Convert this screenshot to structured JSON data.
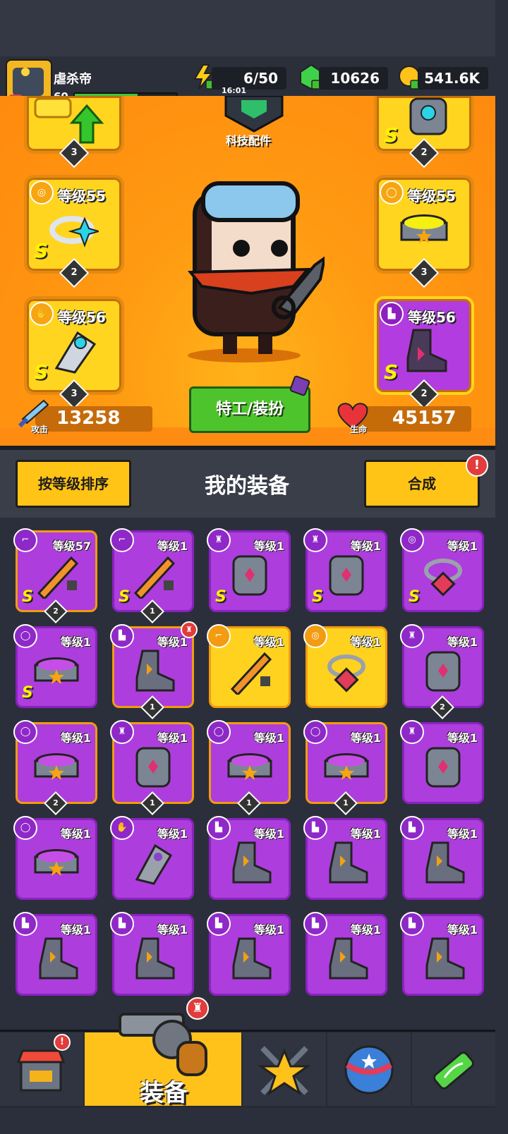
{
  "player": {
    "name": "虐杀帝",
    "level": "60",
    "avatar_level": "54",
    "xp_fraction": 0.62
  },
  "resources": {
    "energy": "6/50",
    "time": "16:01",
    "gems": "10626",
    "coins": "541.6K"
  },
  "colors": {
    "orange": "#ff9a12",
    "yellow": "#ffd21f",
    "purple": "#ad3ddd",
    "green": "#4ec42c"
  },
  "loadout": {
    "tech_label": "科技配件",
    "slots": [
      {
        "name": "weapon-slot",
        "level": "",
        "count": "3",
        "grade": "",
        "icon": "up-arrow-icon"
      },
      {
        "name": "armor-slot",
        "level": "",
        "count": "2",
        "grade": "S",
        "icon": "armor-icon"
      },
      {
        "name": "necklace-slot",
        "level": "等级55",
        "count": "2",
        "grade": "S",
        "icon": "necklace-icon"
      },
      {
        "name": "belt-slot",
        "level": "等级55",
        "count": "3",
        "grade": "",
        "icon": "belt-icon"
      },
      {
        "name": "glove-slot",
        "level": "等级56",
        "count": "3",
        "grade": "S",
        "icon": "glove-icon"
      },
      {
        "name": "boot-slot",
        "level": "等级56",
        "count": "2",
        "grade": "S",
        "icon": "boot-icon"
      }
    ],
    "agent_button": "特工/装扮",
    "attack_label": "攻击",
    "attack_value": "13258",
    "hp_label": "生命",
    "hp_value": "45157"
  },
  "toolbar": {
    "sort_button": "按等级排序",
    "title": "我的装备",
    "merge_button": "合成",
    "merge_alert": "!"
  },
  "items": [
    {
      "kind": "weapon",
      "level": "等级57",
      "grade": "S",
      "count": "2",
      "style": "py"
    },
    {
      "kind": "weapon",
      "level": "等级1",
      "grade": "S",
      "count": "1",
      "style": "p"
    },
    {
      "kind": "armor",
      "level": "等级1",
      "grade": "S",
      "count": "",
      "style": "p"
    },
    {
      "kind": "armor",
      "level": "等级1",
      "grade": "S",
      "count": "",
      "style": "p"
    },
    {
      "kind": "necklace",
      "level": "等级1",
      "grade": "S",
      "count": "",
      "style": "p"
    },
    {
      "kind": "belt",
      "level": "等级1",
      "grade": "S",
      "count": "",
      "style": "p"
    },
    {
      "kind": "boot",
      "level": "等级1",
      "grade": "",
      "count": "1",
      "style": "py",
      "alert": true
    },
    {
      "kind": "weapon",
      "level": "等级1",
      "grade": "",
      "count": "",
      "style": "y"
    },
    {
      "kind": "necklace",
      "level": "等级1",
      "grade": "",
      "count": "",
      "style": "y"
    },
    {
      "kind": "armor",
      "level": "等级1",
      "grade": "",
      "count": "2",
      "style": "p"
    },
    {
      "kind": "belt",
      "level": "等级1",
      "grade": "",
      "count": "2",
      "style": "py"
    },
    {
      "kind": "armor",
      "level": "等级1",
      "grade": "",
      "count": "1",
      "style": "py"
    },
    {
      "kind": "belt",
      "level": "等级1",
      "grade": "",
      "count": "1",
      "style": "py"
    },
    {
      "kind": "belt",
      "level": "等级1",
      "grade": "",
      "count": "1",
      "style": "py"
    },
    {
      "kind": "armor",
      "level": "等级1",
      "grade": "",
      "count": "",
      "style": "p"
    },
    {
      "kind": "belt",
      "level": "等级1",
      "grade": "",
      "count": "",
      "style": "p"
    },
    {
      "kind": "glove",
      "level": "等级1",
      "grade": "",
      "count": "",
      "style": "p"
    },
    {
      "kind": "boot",
      "level": "等级1",
      "grade": "",
      "count": "",
      "style": "p"
    },
    {
      "kind": "boot",
      "level": "等级1",
      "grade": "",
      "count": "",
      "style": "p"
    },
    {
      "kind": "boot",
      "level": "等级1",
      "grade": "",
      "count": "",
      "style": "p"
    },
    {
      "kind": "boot",
      "level": "等级1",
      "grade": "",
      "count": "",
      "style": "p"
    },
    {
      "kind": "boot",
      "level": "等级1",
      "grade": "",
      "count": "",
      "style": "p"
    },
    {
      "kind": "boot",
      "level": "等级1",
      "grade": "",
      "count": "",
      "style": "p"
    },
    {
      "kind": "boot",
      "level": "等级1",
      "grade": "",
      "count": "",
      "style": "p"
    },
    {
      "kind": "boot",
      "level": "等级1",
      "grade": "",
      "count": "",
      "style": "p"
    }
  ],
  "nav": {
    "tabs": [
      {
        "name": "shop-tab",
        "icon": "shop-icon"
      },
      {
        "name": "equipment-tab",
        "label": "装备",
        "icon": "revolver-icon"
      },
      {
        "name": "heroes-tab",
        "icon": "star-icon"
      },
      {
        "name": "world-tab",
        "icon": "globe-icon"
      },
      {
        "name": "lab-tab",
        "icon": "dna-icon"
      }
    ],
    "equipment_label": "装备"
  }
}
